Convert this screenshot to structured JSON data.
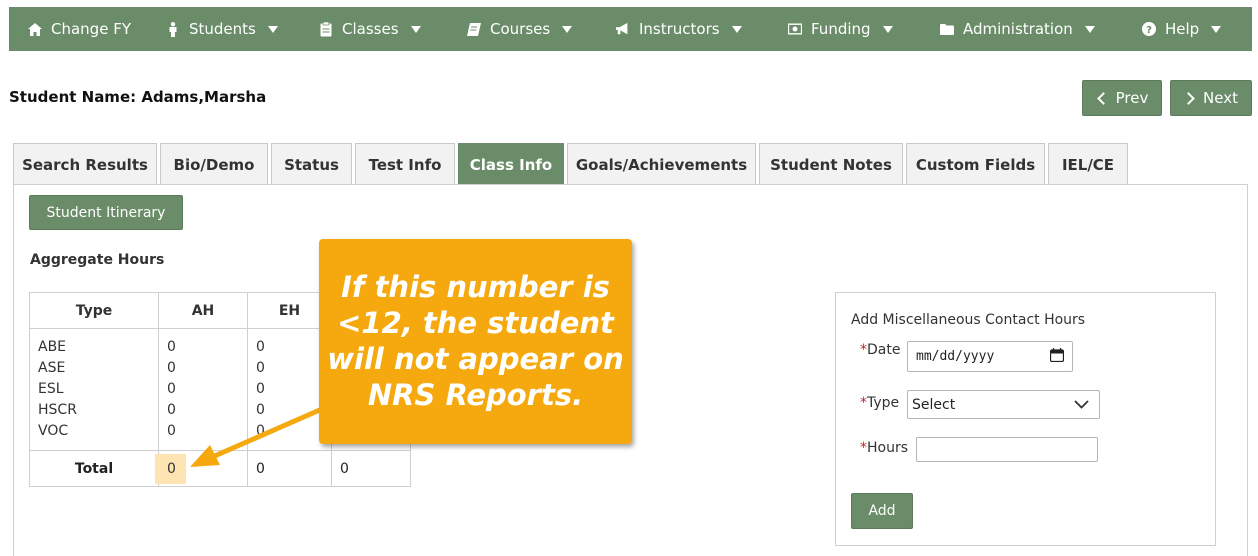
{
  "nav": {
    "items": [
      {
        "label": "Change FY",
        "icon": "home-icon",
        "dropdown": false
      },
      {
        "label": "Students",
        "icon": "person-icon",
        "dropdown": true
      },
      {
        "label": "Classes",
        "icon": "clipboard-icon",
        "dropdown": true
      },
      {
        "label": "Courses",
        "icon": "book-icon",
        "dropdown": true
      },
      {
        "label": "Instructors",
        "icon": "megaphone-icon",
        "dropdown": true
      },
      {
        "label": "Funding",
        "icon": "money-icon",
        "dropdown": true
      },
      {
        "label": "Administration",
        "icon": "folder-icon",
        "dropdown": true
      },
      {
        "label": "Help",
        "icon": "question-icon",
        "dropdown": true
      }
    ]
  },
  "student": {
    "name_label": "Student Name: Adams,Marsha"
  },
  "pager": {
    "prev_label": "Prev",
    "next_label": "Next"
  },
  "tabs": [
    {
      "label": "Search Results",
      "active": false
    },
    {
      "label": "Bio/Demo",
      "active": false
    },
    {
      "label": "Status",
      "active": false
    },
    {
      "label": "Test Info",
      "active": false
    },
    {
      "label": "Class Info",
      "active": true
    },
    {
      "label": "Goals/Achievements",
      "active": false
    },
    {
      "label": "Student Notes",
      "active": false
    },
    {
      "label": "Custom Fields",
      "active": false
    },
    {
      "label": "IEL/CE",
      "active": false
    }
  ],
  "itinerary_button": "Student Itinerary",
  "aggregate": {
    "title": "Aggregate Hours",
    "headers": [
      "Type",
      "AH",
      "EH",
      ""
    ],
    "types": [
      "ABE",
      "ASE",
      "ESL",
      "HSCR",
      "VOC"
    ],
    "ah": [
      "0",
      "0",
      "0",
      "0",
      "0"
    ],
    "eh": [
      "0",
      "0",
      "0",
      "0",
      "0"
    ],
    "total_label": "Total",
    "totals": [
      "0",
      "0",
      "0"
    ]
  },
  "callout": {
    "lines": [
      "If this number is",
      "<12, the student",
      "will not appear on",
      "NRS Reports."
    ]
  },
  "misc": {
    "title": "Add Miscellaneous Contact Hours",
    "date_label": "Date",
    "date_placeholder": "mm/dd/yyyy",
    "type_label": "Type",
    "type_value": "Select",
    "hours_label": "Hours",
    "hours_value": "",
    "required_mark": "*",
    "add_button": "Add"
  },
  "colors": {
    "accent": "#6a8c68",
    "callout": "#f5a90e",
    "highlight": "#fde4b2",
    "required": "#cc2222"
  }
}
